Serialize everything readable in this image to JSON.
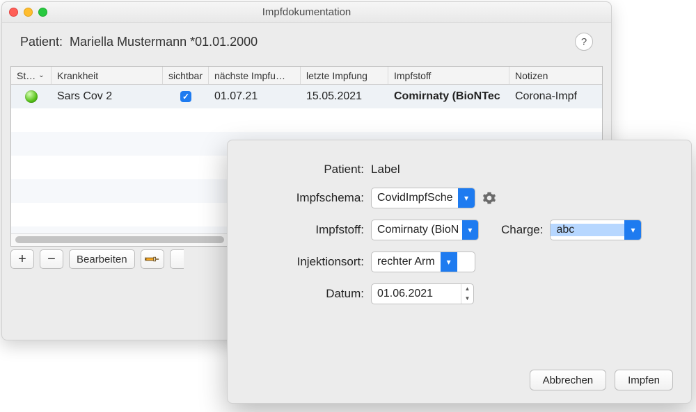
{
  "window": {
    "title": "Impfdokumentation",
    "patient_label": "Patient:",
    "patient_name": "Mariella Mustermann *01.01.2000",
    "help": "?"
  },
  "table": {
    "columns": {
      "status": "St…",
      "krankheit": "Krankheit",
      "sichtbar": "sichtbar",
      "naechste": "nächste Impfu…",
      "letzte": "letzte Impfung",
      "impfstoff": "Impfstoff",
      "notizen": "Notizen"
    },
    "rows": [
      {
        "status": "green",
        "krankheit": "Sars Cov 2",
        "sichtbar": true,
        "naechste": "01.07.21",
        "letzte": "15.05.2021",
        "impfstoff": "Comirnaty (BioNTec",
        "notizen": "Corona-Impf"
      }
    ]
  },
  "toolbar": {
    "add": "+",
    "remove": "−",
    "edit": "Bearbeiten"
  },
  "dialog": {
    "patient_label": "Patient:",
    "patient_value": "Label",
    "impfschema_label": "Impfschema:",
    "impfschema_value": "CovidImpfSche",
    "impfstoff_label": "Impfstoff:",
    "impfstoff_value": "Comirnaty (BioN",
    "charge_label": "Charge:",
    "charge_value": "abc",
    "injektionsort_label": "Injektionsort:",
    "injektionsort_value": "rechter Arm",
    "datum_label": "Datum:",
    "datum_value": "01.06.2021",
    "cancel": "Abbrechen",
    "submit": "Impfen"
  }
}
